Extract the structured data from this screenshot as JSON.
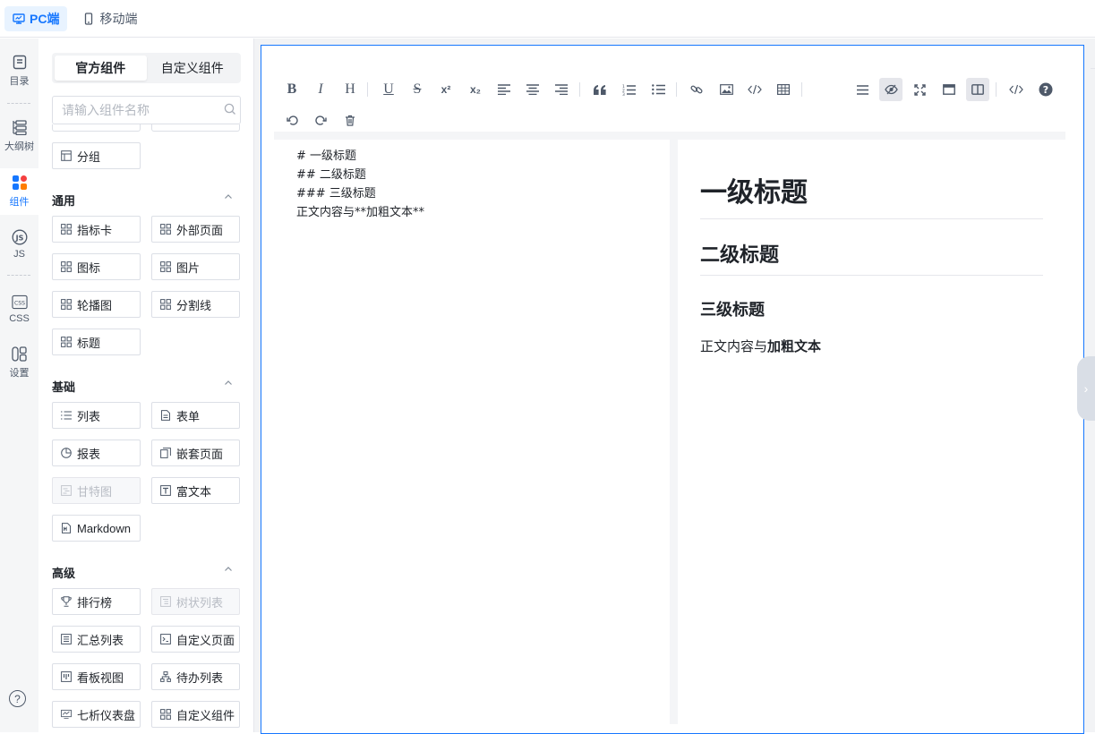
{
  "topbar": {
    "tabs": [
      {
        "label": "PC端",
        "icon": "monitor-icon",
        "active": true
      },
      {
        "label": "移动端",
        "icon": "mobile-icon",
        "active": false
      }
    ]
  },
  "rail": {
    "items": [
      {
        "label": "目录",
        "icon": "catalog-icon"
      },
      {
        "label": "大纲树",
        "icon": "outline-tree-icon"
      },
      {
        "label": "组件",
        "icon": "components-icon",
        "active": true
      },
      {
        "label": "JS",
        "icon": "js-icon"
      },
      {
        "label": "CSS",
        "icon": "css-icon"
      },
      {
        "label": "设置",
        "icon": "settings-icon"
      }
    ],
    "help_icon": "?"
  },
  "panel": {
    "tabs": [
      "官方组件",
      "自定义组件"
    ],
    "active_tab": "官方组件",
    "search_placeholder": "请输入组件名称",
    "pre_items": [
      {
        "label": "分组",
        "icon": "group-icon"
      }
    ],
    "sections": [
      {
        "title": "通用",
        "items": [
          {
            "label": "指标卡",
            "icon": "grid-icon"
          },
          {
            "label": "外部页面",
            "icon": "grid-icon"
          },
          {
            "label": "图标",
            "icon": "grid-icon"
          },
          {
            "label": "图片",
            "icon": "grid-icon"
          },
          {
            "label": "轮播图",
            "icon": "grid-icon"
          },
          {
            "label": "分割线",
            "icon": "grid-icon"
          },
          {
            "label": "标题",
            "icon": "grid-icon"
          }
        ]
      },
      {
        "title": "基础",
        "items": [
          {
            "label": "列表",
            "icon": "list-icon"
          },
          {
            "label": "表单",
            "icon": "form-icon"
          },
          {
            "label": "报表",
            "icon": "pie-chart-icon"
          },
          {
            "label": "嵌套页面",
            "icon": "nested-page-icon"
          },
          {
            "label": "甘特图",
            "icon": "gantt-icon",
            "disabled": true
          },
          {
            "label": "富文本",
            "icon": "rich-text-icon"
          },
          {
            "label": "Markdown",
            "icon": "markdown-icon"
          }
        ]
      },
      {
        "title": "高级",
        "items": [
          {
            "label": "排行榜",
            "icon": "trophy-icon"
          },
          {
            "label": "树状列表",
            "icon": "tree-list-icon",
            "disabled": true
          },
          {
            "label": "汇总列表",
            "icon": "summary-list-icon"
          },
          {
            "label": "自定义页面",
            "icon": "custom-page-icon"
          },
          {
            "label": "看板视图",
            "icon": "kanban-icon"
          },
          {
            "label": "待办列表",
            "icon": "todo-list-icon"
          },
          {
            "label": "七析仪表盘",
            "icon": "dashboard-icon"
          },
          {
            "label": "自定义组件",
            "icon": "grid-icon"
          }
        ]
      }
    ]
  },
  "editor": {
    "toolbar_row1": [
      "B",
      "I",
      "H",
      "U",
      "S",
      "x²",
      "x₂",
      "align-left",
      "align-center",
      "align-right",
      "quote",
      "ordered-list",
      "unordered-list",
      "link",
      "image",
      "code",
      "table"
    ],
    "toolbar_right": [
      "menu",
      "preview-toggle",
      "fullscreen",
      "window",
      "split-view",
      "source-code",
      "help"
    ],
    "toolbar_row2": [
      "undo",
      "redo",
      "clear"
    ],
    "source_lines": [
      "#  一级标题",
      "##  二级标题",
      "###  三级标题",
      "正文内容与**加粗文本**"
    ],
    "preview": {
      "h1": "一级标题",
      "h2": "二级标题",
      "h3": "三级标题",
      "p_plain": "正文内容与",
      "p_bold": "加粗文本"
    }
  }
}
